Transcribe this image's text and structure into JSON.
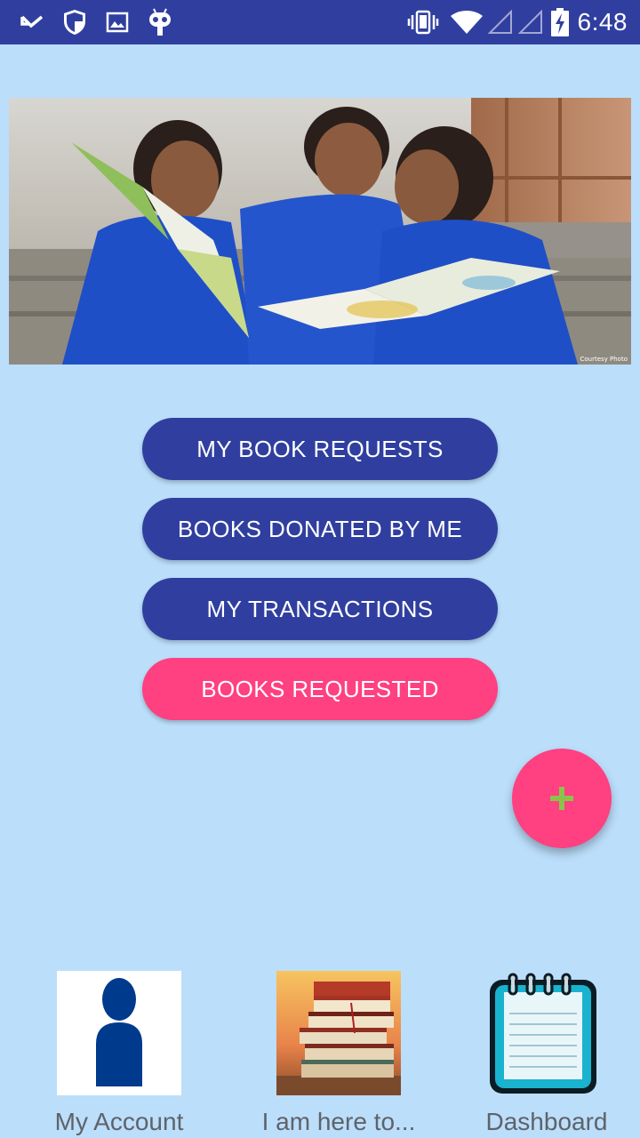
{
  "status_bar": {
    "time": "6:48",
    "icons": [
      "missed-call-icon",
      "shield-icon",
      "image-icon",
      "android-debug-icon",
      "vibrate-icon",
      "wifi-icon",
      "signal-icon",
      "signal-icon",
      "battery-charging-icon"
    ]
  },
  "hero": {
    "courtesy": "Courtesy Photo"
  },
  "actions": {
    "my_book_requests": "MY BOOK REQUESTS",
    "books_donated": "BOOKS DONATED BY ME",
    "my_transactions": "MY TRANSACTIONS",
    "books_requested": "BOOKS REQUESTED"
  },
  "fab": {
    "icon": "plus-icon",
    "symbol": "+"
  },
  "bottom_nav": {
    "account": "My Account",
    "donate": "I am here to...",
    "dashboard": "Dashboard"
  },
  "colors": {
    "primary": "#303f9f",
    "accent": "#ff4081",
    "background": "#bbdefb",
    "fab_plus": "#8bc34a"
  }
}
